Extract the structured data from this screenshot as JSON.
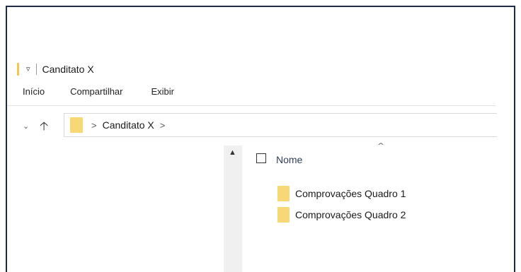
{
  "window": {
    "title": "Canditato X"
  },
  "ribbon": {
    "tabs": [
      {
        "label": "Início"
      },
      {
        "label": "Compartilhar"
      },
      {
        "label": "Exibir"
      }
    ]
  },
  "address": {
    "crumb": "Canditato X",
    "separator": ">"
  },
  "file_list": {
    "column_name": "Nome",
    "items": [
      {
        "name": "Comprovações Quadro 1"
      },
      {
        "name": "Comprovações Quadro 2"
      }
    ]
  },
  "icons": {
    "quick_access": "customize-quick-access-icon",
    "folder": "folder-icon",
    "up": "up-arrow-icon",
    "recent": "chevron-down-icon",
    "scroll_up": "scroll-up-icon",
    "sort": "sort-ascending-icon"
  },
  "colors": {
    "folder": "#f8d775",
    "window_border": "#1f2a44",
    "column_header": "#2e3f5a"
  }
}
